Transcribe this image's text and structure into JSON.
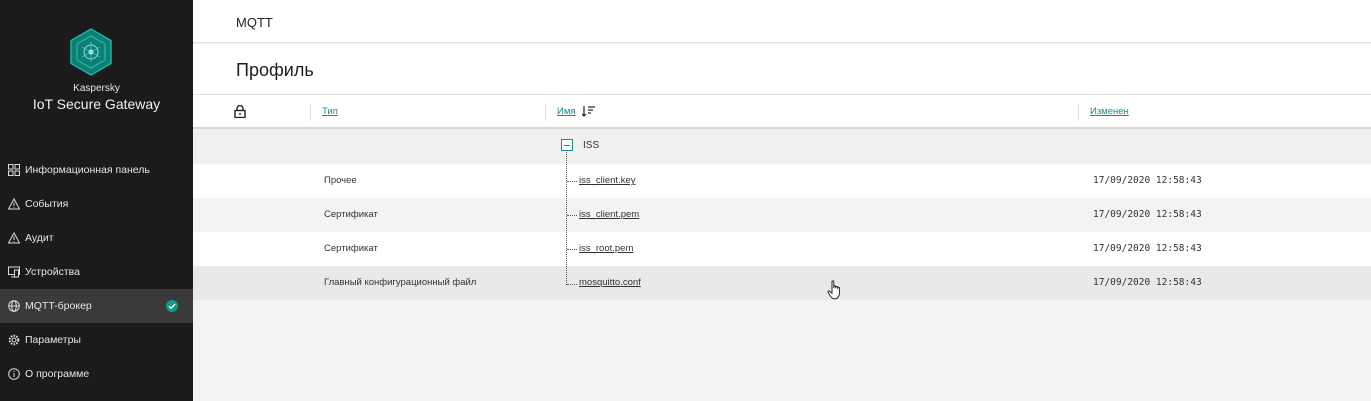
{
  "sidebar": {
    "brand_small": "Kaspersky",
    "brand_big": "IoT Secure Gateway",
    "logo_icon": "kaspersky-hexagon-icon",
    "items": [
      {
        "label": "Информационная панель",
        "icon": "dashboard-icon",
        "active": false
      },
      {
        "label": "События",
        "icon": "warning-triangle-icon",
        "active": false
      },
      {
        "label": "Аудит",
        "icon": "warning-triangle-icon",
        "active": false
      },
      {
        "label": "Устройства",
        "icon": "devices-icon",
        "active": false
      },
      {
        "label": "MQTT-брокер",
        "icon": "globe-icon",
        "active": true
      },
      {
        "label": "Параметры",
        "icon": "gear-icon",
        "active": false
      },
      {
        "label": "О программе",
        "icon": "info-icon",
        "active": false
      }
    ]
  },
  "topbar": {
    "title": "MQTT"
  },
  "page": {
    "title": "Профиль"
  },
  "table": {
    "columns": {
      "type": "Тип",
      "name": "Имя",
      "modified": "Изменен"
    },
    "group": {
      "label": "ISS"
    },
    "rows": [
      {
        "type": "Прочее",
        "name": "iss_client.key",
        "modified": "17/09/2020 12:58:43"
      },
      {
        "type": "Сертификат",
        "name": "iss_client.pem",
        "modified": "17/09/2020 12:58:43"
      },
      {
        "type": "Сертификат",
        "name": "iss_root.pem",
        "modified": "17/09/2020 12:58:43"
      },
      {
        "type": "Главный конфигурационный файл",
        "name": "mosquitto.conf",
        "modified": "17/09/2020 12:58:43"
      }
    ]
  },
  "colors": {
    "accent": "#1a8b8b",
    "sidebar_bg": "#1b1b1b",
    "active_item_bg": "#3a3a3a",
    "badge": "#0f9d8a"
  }
}
